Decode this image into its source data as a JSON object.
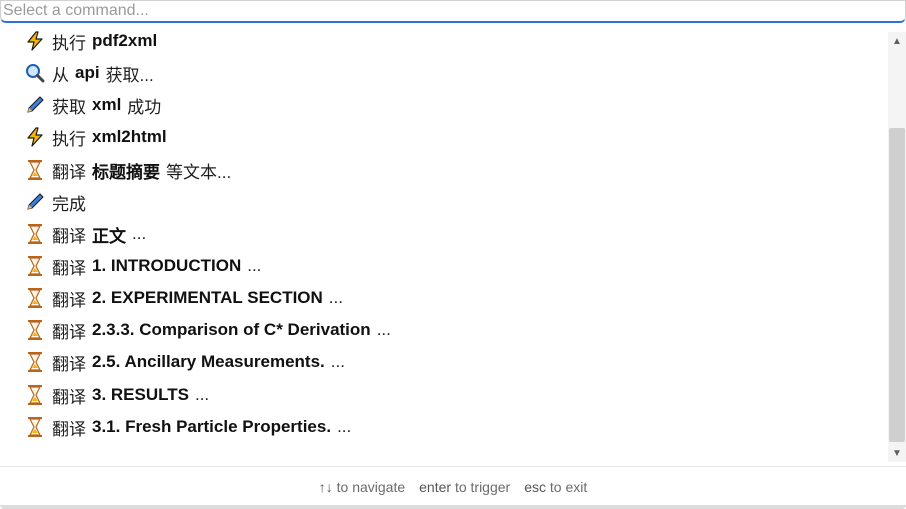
{
  "search": {
    "placeholder": "Select a command..."
  },
  "items": [
    {
      "icon": "lightning-icon",
      "prefix": "执行 ",
      "strong": "pdf2xml",
      "suffix": ""
    },
    {
      "icon": "magnifier-icon",
      "prefix": "从 ",
      "strong": "api",
      "suffix": " 获取..."
    },
    {
      "icon": "pen-icon",
      "prefix": "获取 ",
      "strong": "xml",
      "suffix": " 成功"
    },
    {
      "icon": "lightning-icon",
      "prefix": "执行 ",
      "strong": "xml2html",
      "suffix": ""
    },
    {
      "icon": "hourglass-icon",
      "prefix": "翻译",
      "strong": "标题摘要",
      "suffix": "等文本..."
    },
    {
      "icon": "pen-icon",
      "prefix": "完成",
      "strong": "",
      "suffix": ""
    },
    {
      "icon": "hourglass-icon",
      "prefix": "翻译",
      "strong": "正文",
      "suffix": "..."
    },
    {
      "icon": "hourglass-icon",
      "prefix": "翻译 ",
      "strong": "1. INTRODUCTION",
      "suffix": "..."
    },
    {
      "icon": "hourglass-icon",
      "prefix": "翻译 ",
      "strong": "2. EXPERIMENTAL SECTION",
      "suffix": "..."
    },
    {
      "icon": "hourglass-icon",
      "prefix": "翻译 ",
      "strong": "2.3.3. Comparison of C* Derivation",
      "suffix": "..."
    },
    {
      "icon": "hourglass-icon",
      "prefix": "翻译 ",
      "strong": "2.5. Ancillary Measurements.",
      "suffix": "..."
    },
    {
      "icon": "hourglass-icon",
      "prefix": "翻译 ",
      "strong": "3. RESULTS",
      "suffix": "..."
    },
    {
      "icon": "hourglass-icon",
      "prefix": "翻译 ",
      "strong": "3.1. Fresh Particle Properties.",
      "suffix": "..."
    }
  ],
  "footer": {
    "navigate_key": "↑↓",
    "navigate_label": "to navigate",
    "trigger_key": "enter",
    "trigger_label": "to trigger",
    "exit_key": "esc",
    "exit_label": "to exit"
  },
  "colors": {
    "accent": "#2f6fd6",
    "scroll_thumb": "#cfcfcf"
  }
}
